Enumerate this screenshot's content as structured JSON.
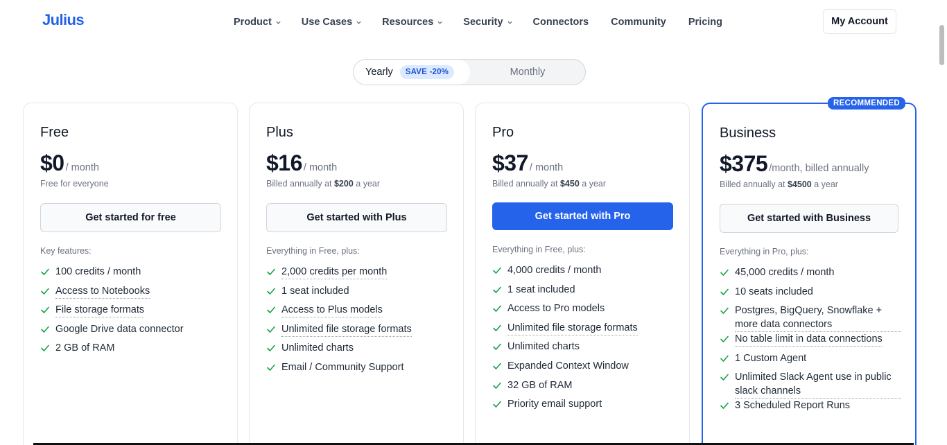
{
  "header": {
    "logo": "Julius",
    "nav": [
      {
        "label": "Product",
        "has_menu": true
      },
      {
        "label": "Use Cases",
        "has_menu": true
      },
      {
        "label": "Resources",
        "has_menu": true
      },
      {
        "label": "Security",
        "has_menu": true
      },
      {
        "label": "Connectors",
        "has_menu": false
      },
      {
        "label": "Community",
        "has_menu": false
      },
      {
        "label": "Pricing",
        "has_menu": false
      }
    ],
    "account_button": "My Account"
  },
  "billing_toggle": {
    "yearly_label": "Yearly",
    "save_badge": "SAVE -20%",
    "monthly_label": "Monthly",
    "selected": "Yearly"
  },
  "colors": {
    "accent": "#2563eb",
    "check": "#16a34a"
  },
  "plans": [
    {
      "name": "Free",
      "price": "$0",
      "per": "/ month",
      "billed_prefix": "Free for everyone",
      "billed_amount": "",
      "billed_suffix": "",
      "cta": "Get started for free",
      "features_label": "Key features:",
      "features": [
        {
          "text": "100 credits / month",
          "dotted": false
        },
        {
          "text": "Access to Notebooks",
          "dotted": true
        },
        {
          "text": "File storage formats",
          "dotted": true
        },
        {
          "text": "Google Drive data connector",
          "dotted": false
        },
        {
          "text": "2 GB of RAM",
          "dotted": false
        }
      ]
    },
    {
      "name": "Plus",
      "price": "$16",
      "per": "/ month",
      "billed_prefix": "Billed annually at ",
      "billed_amount": "$200",
      "billed_suffix": " a year",
      "cta": "Get started with Plus",
      "features_label": "Everything in Free, plus:",
      "features": [
        {
          "text": "2,000 credits per month",
          "dotted": true
        },
        {
          "text": "1 seat included",
          "dotted": false
        },
        {
          "text": "Access to Plus models",
          "dotted": true
        },
        {
          "text": "Unlimited file storage formats",
          "dotted": true
        },
        {
          "text": "Unlimited charts",
          "dotted": false
        },
        {
          "text": "Email / Community Support",
          "dotted": false
        }
      ]
    },
    {
      "name": "Pro",
      "price": "$37",
      "per": "/ month",
      "billed_prefix": "Billed annually at ",
      "billed_amount": "$450",
      "billed_suffix": " a year",
      "cta": "Get started with Pro",
      "features_label": "Everything in Free, plus:",
      "features": [
        {
          "text": "4,000 credits / month",
          "dotted": false
        },
        {
          "text": "1 seat included",
          "dotted": false
        },
        {
          "text": "Access to Pro models",
          "dotted": false
        },
        {
          "text": "Unlimited file storage formats",
          "dotted": true
        },
        {
          "text": "Unlimited charts",
          "dotted": false
        },
        {
          "text": "Expanded Context Window",
          "dotted": false
        },
        {
          "text": "32 GB of RAM",
          "dotted": false
        },
        {
          "text": "Priority email support",
          "dotted": false
        }
      ]
    },
    {
      "name": "Business",
      "badge": "RECOMMENDED",
      "price": "$375",
      "per": "/month, billed annually",
      "billed_prefix": "Billed annually at ",
      "billed_amount": "$4500",
      "billed_suffix": " a year",
      "cta": "Get started with Business",
      "features_label": "Everything in Pro, plus:",
      "features": [
        {
          "text": "45,000 credits / month",
          "dotted": false
        },
        {
          "text": "10 seats included",
          "dotted": false
        },
        {
          "text": "Postgres, BigQuery, Snowflake + more data connectors",
          "dotted": true
        },
        {
          "text": "No table limit in data connections",
          "dotted": true
        },
        {
          "text": "1 Custom Agent",
          "dotted": false
        },
        {
          "text": "Unlimited Slack Agent use in public slack channels",
          "dotted": true
        },
        {
          "text": "3 Scheduled Report Runs",
          "dotted": false
        }
      ]
    }
  ]
}
